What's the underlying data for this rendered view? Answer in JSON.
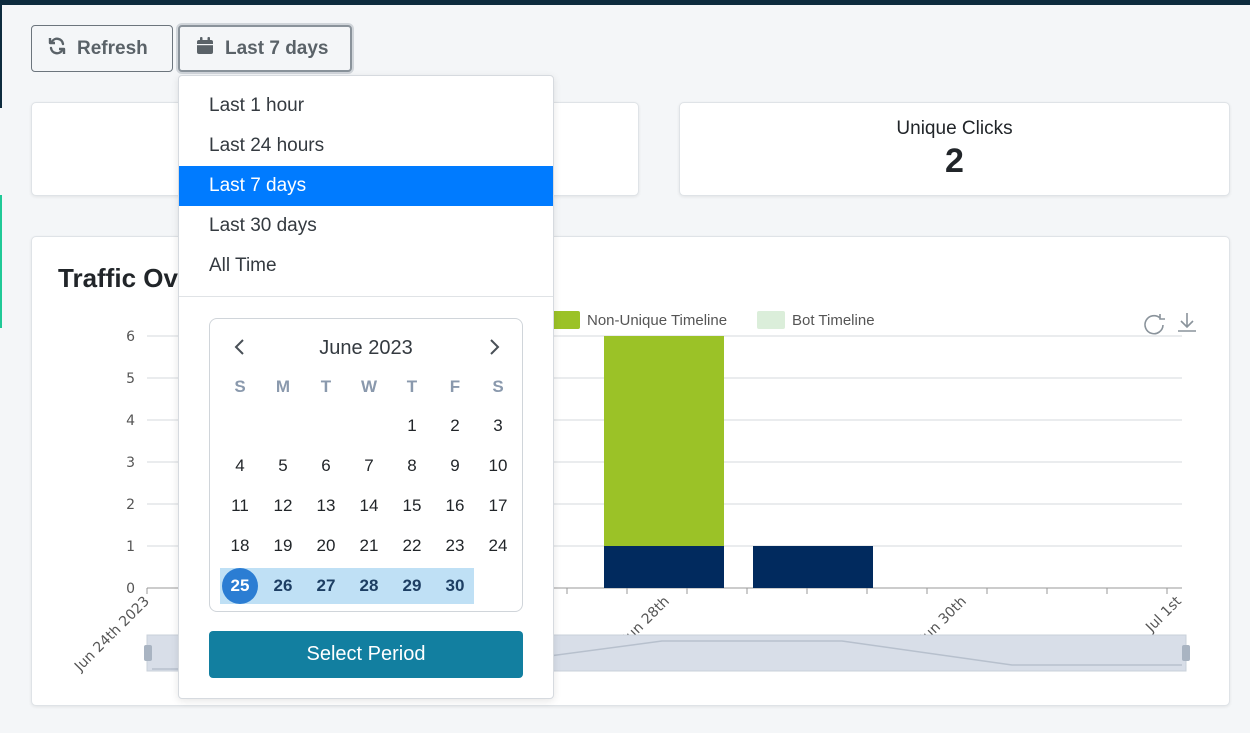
{
  "toolbar": {
    "refresh_label": "Refresh",
    "range_label": "Last 7 days"
  },
  "stats": {
    "unique_clicks_label": "Unique Clicks",
    "unique_clicks_value": "2"
  },
  "chart": {
    "title": "Traffic Ov",
    "legend": [
      {
        "name": "Non-Unique Timeline",
        "color": "#9bc227"
      },
      {
        "name": "Bot Timeline",
        "color": "#dbeeda"
      }
    ],
    "bar_colors": {
      "unique": "#012a5e",
      "non_unique": "#9bc227"
    }
  },
  "chart_data": {
    "type": "bar",
    "stacked": true,
    "title": "Traffic Ov",
    "ylim": [
      0,
      6
    ],
    "yticks": [
      0,
      1,
      2,
      3,
      4,
      5,
      6
    ],
    "x_tick_labels": [
      "Jun 24th 2023",
      "Jun 28th",
      "Jun 30th",
      "Jul 1st"
    ],
    "grid": true,
    "bars": [
      {
        "segments": [
          {
            "series": "unique",
            "value": 1
          },
          {
            "series": "Non-Unique Timeline",
            "value": 5
          }
        ]
      },
      {
        "segments": [
          {
            "series": "unique",
            "value": 1
          }
        ]
      }
    ]
  },
  "dropdown": {
    "options": [
      {
        "label": "Last 1 hour"
      },
      {
        "label": "Last 24 hours"
      },
      {
        "label": "Last 7 days",
        "active": true
      },
      {
        "label": "Last 30 days"
      },
      {
        "label": "All Time"
      }
    ],
    "calendar": {
      "month": "June 2023",
      "weekdays": [
        "S",
        "M",
        "T",
        "W",
        "T",
        "F",
        "S"
      ],
      "leading_blanks": 4,
      "days_in_month": 30,
      "range_start": 25,
      "range_end": 30
    },
    "select_label": "Select Period"
  }
}
